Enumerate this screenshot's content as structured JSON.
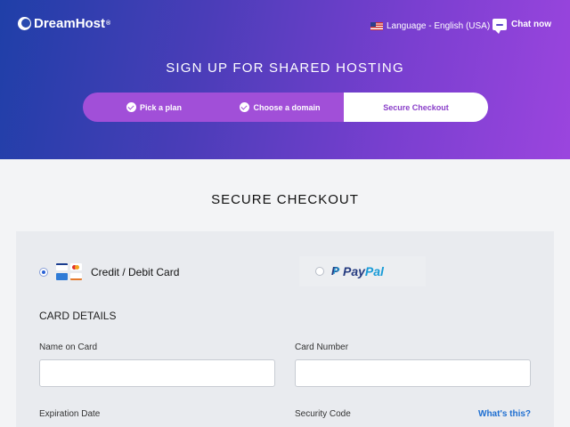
{
  "header": {
    "brand": "DreamHost",
    "brand_mark": "®",
    "language": "Language - English (USA)",
    "chat": "Chat now",
    "icons": {
      "logo": "dreamhost-moon-icon",
      "flag": "us-flag-icon",
      "chat": "chat-bubble-icon"
    }
  },
  "hero": {
    "title": "SIGN UP FOR SHARED HOSTING",
    "steps": [
      {
        "label": "Pick a plan",
        "state": "complete"
      },
      {
        "label": "Choose a domain",
        "state": "complete"
      },
      {
        "label": "Secure Checkout",
        "state": "active"
      }
    ]
  },
  "checkout": {
    "title": "SECURE CHECKOUT",
    "payment_methods": {
      "card": {
        "label": "Credit / Debit Card",
        "selected": true
      },
      "paypal": {
        "label_pay": "Pay",
        "label_pal": "Pal",
        "selected": false
      }
    },
    "card_details": {
      "heading": "CARD DETAILS",
      "name_label": "Name on Card",
      "name_value": "",
      "number_label": "Card Number",
      "number_value": "",
      "expiration_label": "Expiration Date",
      "security_label": "Security Code",
      "whats_this": "What's this?"
    }
  },
  "colors": {
    "hero_start": "#1f3fa8",
    "hero_end": "#9b45de",
    "step_active_text": "#8a3fc9",
    "link": "#1f6fd1"
  }
}
